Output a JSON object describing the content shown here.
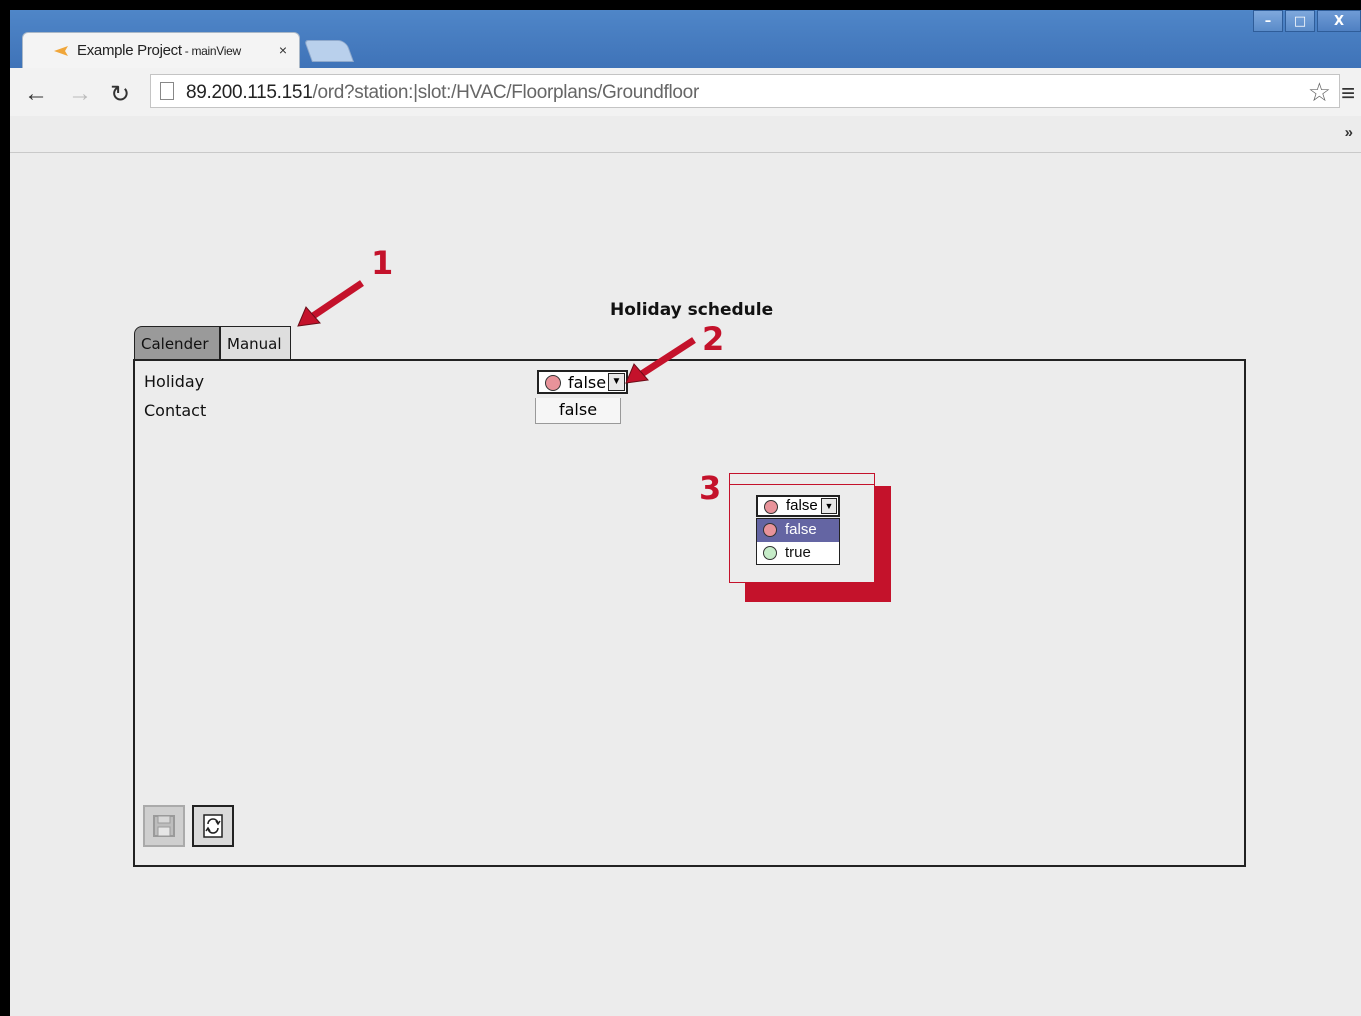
{
  "browser": {
    "tab_title": "Example Project",
    "tab_subtitle": " - mainView",
    "tab_close": "×",
    "url_host": "89.200.115.151",
    "url_path": "/ord?station:|slot:/HVAC/Floorplans/Groundfloor",
    "bookmarks_more": "»",
    "window_controls": {
      "minimize": "–",
      "maximize": "□",
      "close": "X"
    },
    "icons": [
      "back-arrow-icon",
      "forward-arrow-icon",
      "reload-icon",
      "page-icon",
      "star-icon",
      "menu-icon"
    ]
  },
  "app": {
    "title": "Holiday schedule",
    "tabs": [
      {
        "label": "Calender"
      },
      {
        "label": "Manual"
      }
    ],
    "fields": {
      "holiday_label": "Holiday",
      "contact_label": "Contact",
      "holiday_value": "false",
      "contact_value": "false"
    },
    "buttons": [
      "save-icon",
      "refresh-icon"
    ]
  },
  "callout": {
    "selected": "false",
    "options": [
      {
        "label": "false",
        "color": "#e8939a"
      },
      {
        "label": "true",
        "color": "#c6ecc8"
      }
    ]
  },
  "annotations": [
    "1",
    "2",
    "3"
  ],
  "colors": {
    "annotation": "#c4122b",
    "selected_option": "#6465a3",
    "titlebar": "#4f86c8"
  }
}
